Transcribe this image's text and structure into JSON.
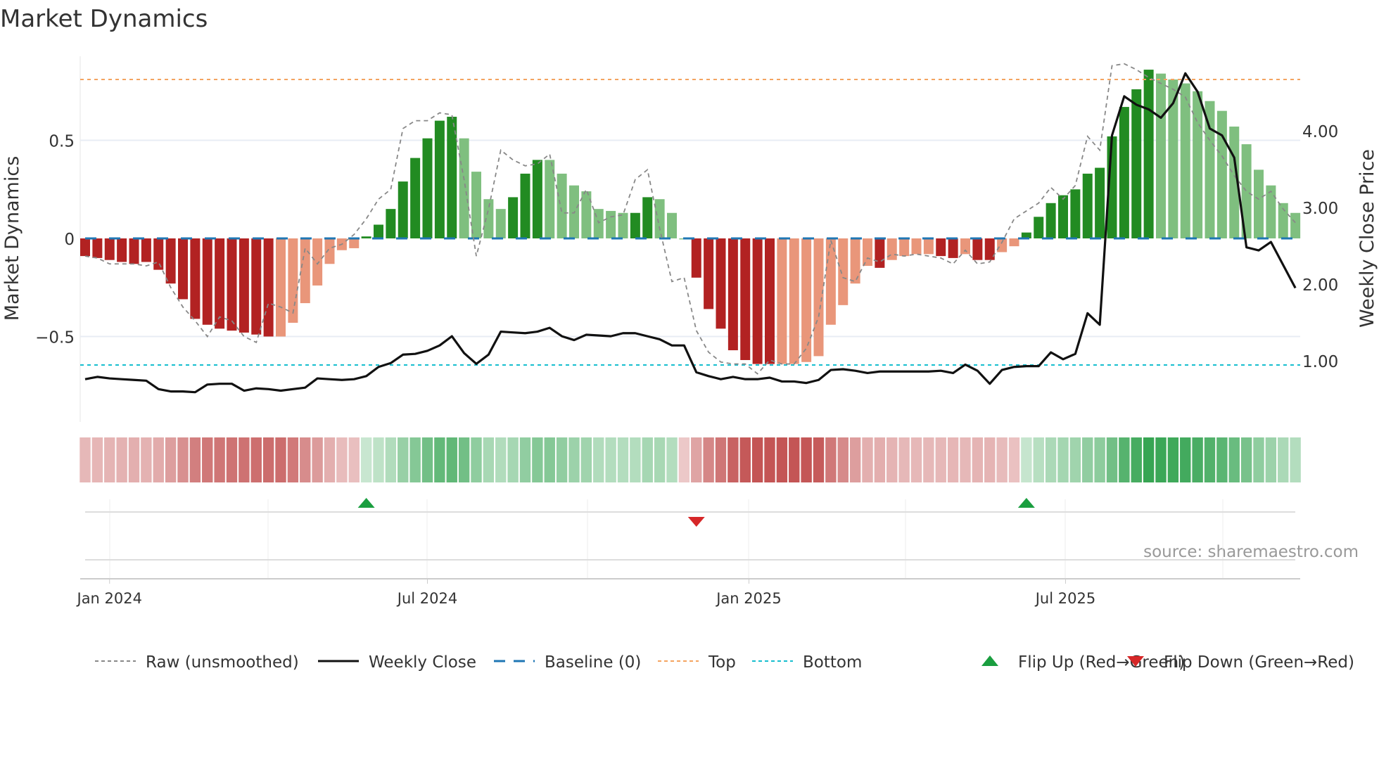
{
  "chart_data": {
    "type": "bar",
    "title": "Market Dynamics",
    "ylabel": "Market Dynamics",
    "y2label": "Weekly Close Price",
    "ylim": [
      -0.87,
      0.95
    ],
    "y2lim": [
      0.3,
      4.9
    ],
    "yticks": [
      {
        "v": 0.5,
        "label": "0.5"
      },
      {
        "v": 0,
        "label": "0"
      },
      {
        "v": -0.5,
        "label": "−0.5"
      }
    ],
    "y2ticks": [
      {
        "v": 4,
        "label": "4.00"
      },
      {
        "v": 3,
        "label": "3.00"
      },
      {
        "v": 2,
        "label": "2.00"
      },
      {
        "v": 1,
        "label": "1.00"
      }
    ],
    "xticks": [
      {
        "week": 2,
        "label": "Jan 2024"
      },
      {
        "week": 28,
        "label": "Jul 2024"
      },
      {
        "week": 54.3,
        "label": "Jan 2025"
      },
      {
        "week": 80.2,
        "label": "Jul 2025"
      }
    ],
    "top_level": 0.81,
    "bottom_level": -0.645,
    "baseline": 0,
    "values": [
      -0.09,
      -0.1,
      -0.11,
      -0.12,
      -0.13,
      -0.12,
      -0.16,
      -0.23,
      -0.31,
      -0.41,
      -0.44,
      -0.46,
      -0.47,
      -0.48,
      -0.49,
      -0.5,
      -0.5,
      -0.43,
      -0.33,
      -0.24,
      -0.13,
      -0.06,
      -0.05,
      0.01,
      0.07,
      0.15,
      0.29,
      0.41,
      0.51,
      0.6,
      0.62,
      0.51,
      0.34,
      0.2,
      0.15,
      0.21,
      0.33,
      0.4,
      0.4,
      0.33,
      0.27,
      0.24,
      0.15,
      0.14,
      0.13,
      0.13,
      0.21,
      0.2,
      0.13,
      -0.005,
      -0.2,
      -0.36,
      -0.46,
      -0.57,
      -0.62,
      -0.64,
      -0.64,
      -0.64,
      -0.64,
      -0.63,
      -0.6,
      -0.44,
      -0.34,
      -0.23,
      -0.14,
      -0.15,
      -0.11,
      -0.09,
      -0.08,
      -0.08,
      -0.09,
      -0.1,
      -0.08,
      -0.11,
      -0.11,
      -0.07,
      -0.04,
      0.03,
      0.11,
      0.18,
      0.22,
      0.25,
      0.33,
      0.36,
      0.52,
      0.67,
      0.76,
      0.86,
      0.84,
      0.81,
      0.79,
      0.75,
      0.7,
      0.65,
      0.57,
      0.48,
      0.35,
      0.27,
      0.18,
      0.13
    ],
    "bar_shade": [
      "dr",
      "dr",
      "dr",
      "dr",
      "dr",
      "dr",
      "dr",
      "dr",
      "dr",
      "dr",
      "dr",
      "dr",
      "dr",
      "dr",
      "dr",
      "dr",
      "lr",
      "lr",
      "lr",
      "lr",
      "lr",
      "lr",
      "lr",
      "dg",
      "dg",
      "dg",
      "dg",
      "dg",
      "dg",
      "dg",
      "dg",
      "lg",
      "lg",
      "lg",
      "lg",
      "dg",
      "dg",
      "dg",
      "lg",
      "lg",
      "lg",
      "lg",
      "lg",
      "lg",
      "lg",
      "dg",
      "dg",
      "lg",
      "lg",
      "lg",
      "dr",
      "dr",
      "dr",
      "dr",
      "dr",
      "dr",
      "dr",
      "lr",
      "lr",
      "lr",
      "lr",
      "lr",
      "lr",
      "lr",
      "lr",
      "dr",
      "lr",
      "lr",
      "lr",
      "lr",
      "dr",
      "dr",
      "lr",
      "dr",
      "dr",
      "lr",
      "lr",
      "dg",
      "dg",
      "dg",
      "dg",
      "dg",
      "dg",
      "dg",
      "dg",
      "dg",
      "dg",
      "dg",
      "lg",
      "lg",
      "lg",
      "lg",
      "lg",
      "lg",
      "lg",
      "lg",
      "lg",
      "lg",
      "lg",
      "lg"
    ],
    "raw": [
      -0.09,
      -0.1,
      -0.13,
      -0.13,
      -0.13,
      -0.14,
      -0.12,
      -0.25,
      -0.35,
      -0.42,
      -0.5,
      -0.4,
      -0.42,
      -0.5,
      -0.53,
      -0.33,
      -0.35,
      -0.38,
      -0.05,
      -0.13,
      -0.05,
      -0.03,
      0.02,
      0.1,
      0.2,
      0.25,
      0.56,
      0.6,
      0.6,
      0.64,
      0.63,
      0.3,
      -0.09,
      0.15,
      0.45,
      0.4,
      0.37,
      0.38,
      0.43,
      0.13,
      0.13,
      0.25,
      0.08,
      0.11,
      0.12,
      0.3,
      0.35,
      0.05,
      -0.22,
      -0.2,
      -0.47,
      -0.58,
      -0.63,
      -0.64,
      -0.64,
      -0.69,
      -0.62,
      -0.64,
      -0.64,
      -0.56,
      -0.4,
      -0.01,
      -0.2,
      -0.22,
      -0.1,
      -0.12,
      -0.08,
      -0.09,
      -0.08,
      -0.09,
      -0.1,
      -0.13,
      -0.06,
      -0.13,
      -0.12,
      -0.02,
      0.1,
      0.14,
      0.18,
      0.26,
      0.2,
      0.27,
      0.52,
      0.45,
      0.88,
      0.89,
      0.86,
      0.82,
      0.79,
      0.76,
      0.72,
      0.59,
      0.5,
      0.42,
      0.32,
      0.24,
      0.2,
      0.24,
      0.15,
      0.08
    ],
    "close": [
      0.76,
      0.79,
      0.77,
      0.76,
      0.75,
      0.74,
      0.63,
      0.6,
      0.6,
      0.59,
      0.69,
      0.7,
      0.7,
      0.61,
      0.64,
      0.63,
      0.61,
      0.63,
      0.65,
      0.77,
      0.76,
      0.75,
      0.76,
      0.8,
      0.92,
      0.97,
      1.08,
      1.09,
      1.13,
      1.2,
      1.32,
      1.1,
      0.96,
      1.08,
      1.38,
      1.37,
      1.36,
      1.38,
      1.43,
      1.32,
      1.27,
      1.34,
      1.33,
      1.32,
      1.36,
      1.36,
      1.32,
      1.28,
      1.2,
      1.2,
      0.85,
      0.8,
      0.76,
      0.79,
      0.76,
      0.76,
      0.78,
      0.73,
      0.73,
      0.71,
      0.75,
      0.88,
      0.89,
      0.87,
      0.84,
      0.86,
      0.86,
      0.86,
      0.86,
      0.86,
      0.87,
      0.84,
      0.95,
      0.87,
      0.7,
      0.88,
      0.92,
      0.93,
      0.93,
      1.11,
      1.02,
      1.09,
      1.62,
      1.47,
      3.94,
      4.45,
      4.34,
      4.28,
      4.17,
      4.36,
      4.75,
      4.51,
      4.03,
      3.94,
      3.65,
      2.48,
      2.44,
      2.55,
      2.25,
      1.95
    ],
    "flips": [
      {
        "week": 23,
        "dir": "up"
      },
      {
        "week": 50,
        "dir": "down"
      },
      {
        "week": 77,
        "dir": "up"
      }
    ],
    "legend": [
      {
        "label": "Raw (unsmoothed)",
        "kind": "raw"
      },
      {
        "label": "Weekly Close",
        "kind": "close"
      },
      {
        "label": "Baseline (0)",
        "kind": "baseline"
      },
      {
        "label": "Top",
        "kind": "top"
      },
      {
        "label": "Bottom",
        "kind": "bottom"
      },
      {
        "label": "Flip Up (Red→Green)",
        "kind": "up"
      },
      {
        "label": "Flip Down (Green→Red)",
        "kind": "down"
      }
    ],
    "legend_position": "bottom",
    "source": "source: sharemaestro.com",
    "colors": {
      "dr": "#b22222",
      "lr": "#e9967a",
      "dg": "#228b22",
      "lg": "#7fbf7f",
      "top": "#f4a460",
      "bottom": "#17becf",
      "baseline": "#1f77b4",
      "up": "#1a9e3f",
      "down": "#d62728"
    }
  }
}
